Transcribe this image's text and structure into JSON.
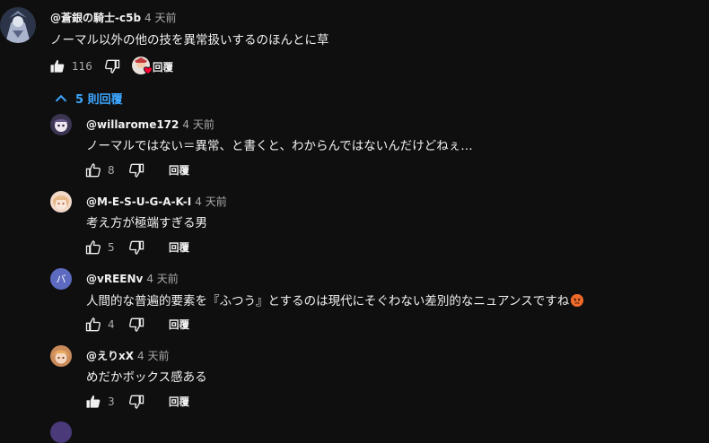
{
  "comment": {
    "author": "@蒼銀の騎士-c5b",
    "time": "4 天前",
    "text": "ノーマル以外の他の技を異常扱いするのほんとに草",
    "likes": "116",
    "reply_label": "回覆"
  },
  "replies_toggle": {
    "label": "5 則回覆",
    "icon": "chevron-up-icon"
  },
  "replies": [
    {
      "author": "@willarome172",
      "time": "4 天前",
      "text": "ノーマルではない＝異常、と書くと、わからんではないんだけどねぇ…",
      "likes": "8",
      "reply_label": "回覆"
    },
    {
      "author": "@M-E-S-U-G-A-K-I",
      "time": "4 天前",
      "text": "考え方が極端すぎる男",
      "likes": "5",
      "reply_label": "回覆"
    },
    {
      "author": "@vREENv",
      "time": "4 天前",
      "text": "人間的な普遍的要素を『ふつう』とするのは現代にそぐわない差別的なニュアンスですね",
      "emoji": "angry-face-icon",
      "likes": "4",
      "reply_label": "回覆",
      "avatar_letter": "バ",
      "avatar_color": "#5c6bc0"
    },
    {
      "author": "@えりxX",
      "time": "4 天前",
      "text": "めだかボックス感ある",
      "likes": "3",
      "reply_label": "回覆"
    }
  ],
  "colors": {
    "background": "#0f0f0f",
    "link": "#3ea6ff",
    "muted": "#aaaaaa",
    "heart": "#ff0033"
  }
}
